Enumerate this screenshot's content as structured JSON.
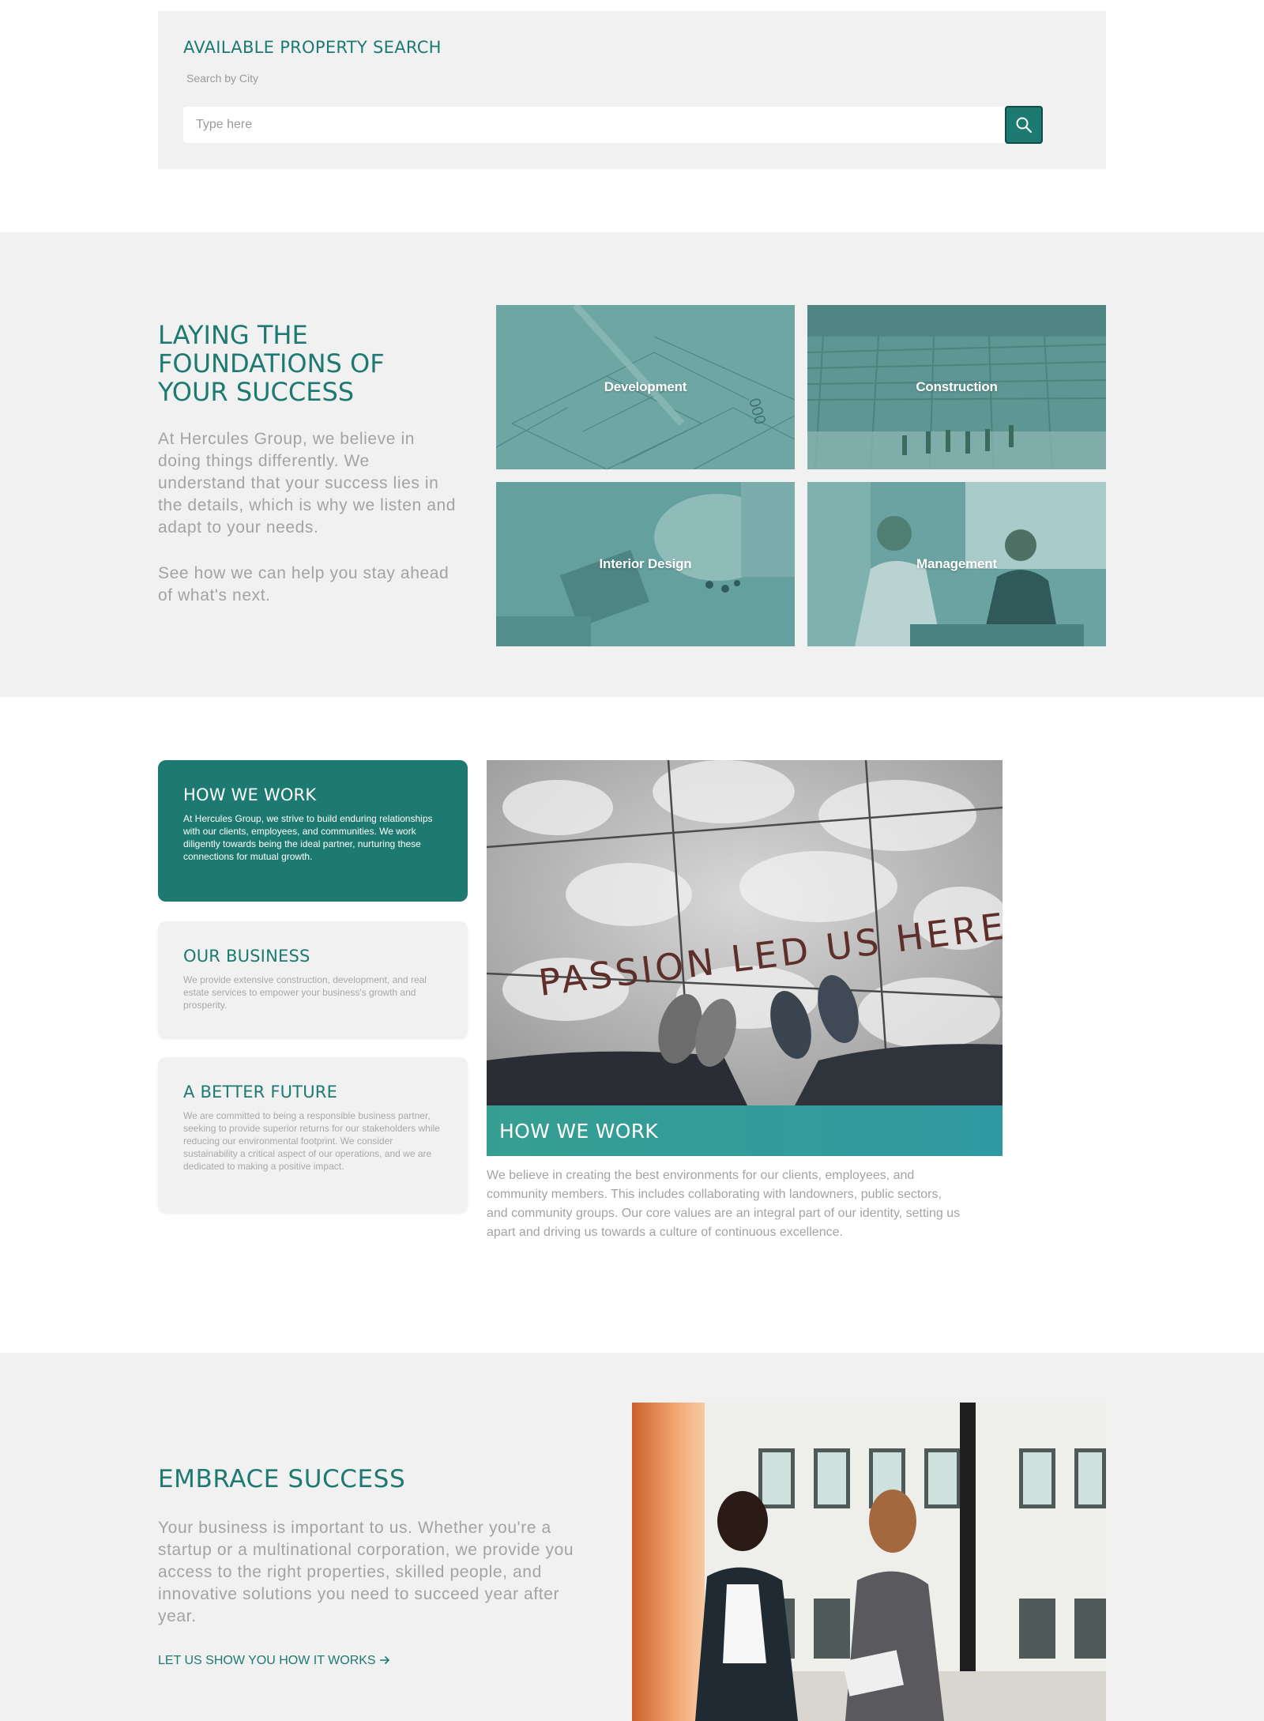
{
  "search": {
    "title": "AVAILABLE PROPERTY SEARCH",
    "label": "Search by City",
    "placeholder": "Type here",
    "button_icon": "search-icon"
  },
  "foundations": {
    "title": "LAYING THE FOUNDATIONS OF YOUR SUCCESS",
    "paragraph1": "At Hercules Group, we believe in doing things differently. We understand that your success lies in the details, which is why we listen and adapt to your needs.",
    "paragraph2": "See how we can help you stay ahead of what's next.",
    "tiles": [
      {
        "label": "Development"
      },
      {
        "label": "Construction"
      },
      {
        "label": "Interior Design"
      },
      {
        "label": "Management"
      }
    ]
  },
  "work": {
    "cards": [
      {
        "title": "HOW WE WORK",
        "text": "At Hercules Group, we strive to build enduring relationships with our clients, employees, and communities. We work diligently towards being the ideal partner, nurturing these connections for mutual growth."
      },
      {
        "title": "OUR BUSINESS",
        "text": "We provide extensive construction, development, and real estate services to empower your business's growth and prosperity."
      },
      {
        "title": "A BETTER FUTURE",
        "text": "We are committed to being a responsible business partner, seeking to provide superior returns for our stakeholders while reducing our environmental footprint. We consider sustainability a critical aspect of our operations, and we are dedicated to making a positive impact."
      }
    ],
    "image_text": "PASSION LED US HERE",
    "banner": "HOW WE WORK",
    "description": "We believe in creating the best environments for our clients, employees, and community members. This includes collaborating with landowners, public sectors, and community groups. Our core values are an integral part of our identity, setting us apart and driving us towards a culture of continuous excellence."
  },
  "embrace": {
    "title": "EMBRACE SUCCESS",
    "text": "Your business is important to us. Whether you're a startup or a multinational corporation, we provide you access to the right properties, skilled people, and innovative solutions you need to succeed year after year.",
    "link": "LET US SHOW YOU HOW IT WORKS",
    "link_icon": "arrow-right-icon"
  },
  "colors": {
    "brand": "#1d7a70",
    "banner": "#339c98",
    "section_bg": "#f1f1f1"
  }
}
